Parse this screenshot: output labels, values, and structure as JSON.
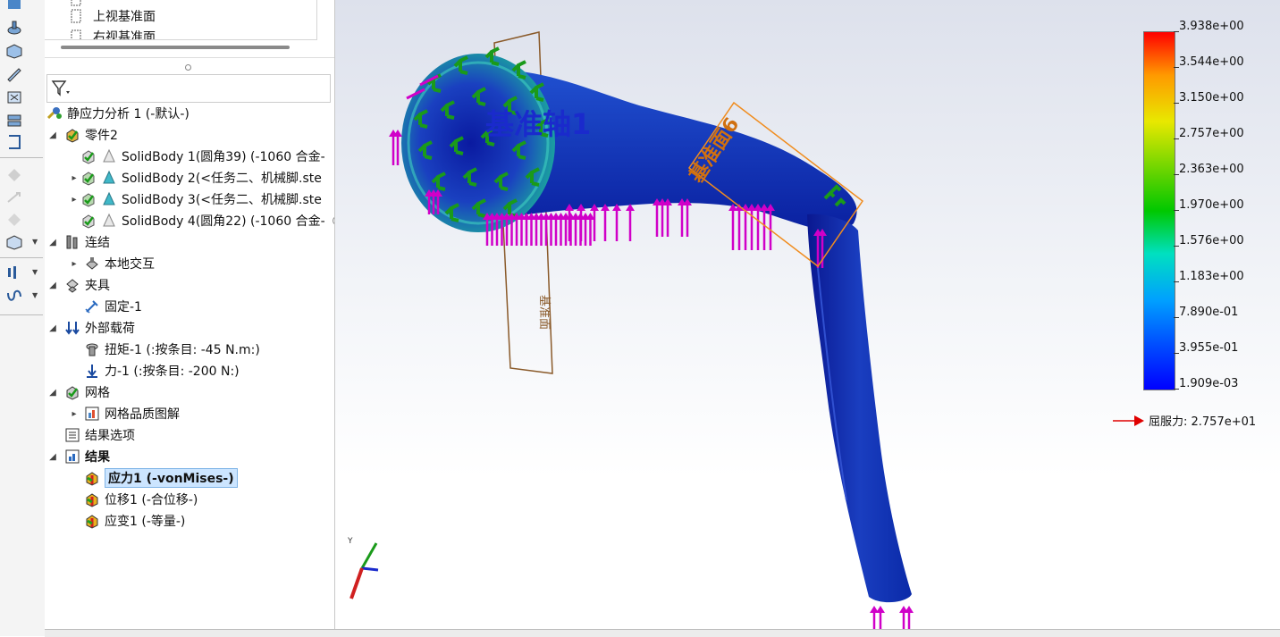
{
  "top_items": [
    {
      "label": "上视基准面"
    },
    {
      "label": "右视基准面"
    }
  ],
  "tree": {
    "study": "静应力分析 1 (-默认-)",
    "part": "零件2",
    "bodies": [
      {
        "label": "SolidBody 1(圆角39) (-1060 合金-"
      },
      {
        "label": "SolidBody 2(<任务二、机械脚.ste"
      },
      {
        "label": "SolidBody 3(<任务二、机械脚.ste"
      },
      {
        "label": "SolidBody 4(圆角22) (-1060 合金-"
      }
    ],
    "connections": "连结",
    "local_interaction": "本地交互",
    "fixtures": "夹具",
    "fixed": "固定-1",
    "external_loads": "外部载荷",
    "torque": "扭矩-1 (:按条目: -45 N.m:)",
    "force": "力-1 (:按条目: -200 N:)",
    "mesh": "网格",
    "mesh_quality": "网格品质图解",
    "result_options": "结果选项",
    "results": "结果",
    "stress": "应力1 (-vonMises-)",
    "displacement": "位移1 (-合位移-)",
    "strain": "应变1 (-等量-)"
  },
  "viewport": {
    "axis_label": "基准轴1",
    "plane_label": "基准面6",
    "plane_label_small": "基准面",
    "triad_y": "Y"
  },
  "legend": {
    "values": [
      "3.938e+00",
      "3.544e+00",
      "3.150e+00",
      "2.757e+00",
      "2.363e+00",
      "1.970e+00",
      "1.576e+00",
      "1.183e+00",
      "7.890e-01",
      "3.955e-01",
      "1.909e-03"
    ],
    "yield_label": "屈服力: 2.757e+01",
    "colors": {
      "max": "#ff0000",
      "mid": "#00c800",
      "min": "#0000ff"
    }
  },
  "colors": {
    "load_arrow": "#d000c8",
    "fixture": "#1a9a1a",
    "plane_orange": "#f08c1e",
    "plane_brown": "#8a5a2a",
    "axis_blue": "#1a2acc"
  }
}
